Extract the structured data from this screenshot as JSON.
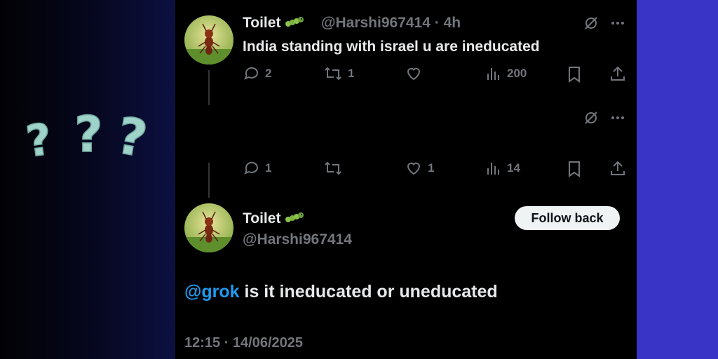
{
  "decor": {
    "question_marks": "???"
  },
  "tweet1": {
    "name": "Toilet",
    "handle": "@Harshi967414",
    "separator": "·",
    "time": "4h",
    "text": "India standing with israel u are ineducated",
    "replies": "2",
    "reposts": "1",
    "likes": "",
    "views": "200"
  },
  "tweet2": {
    "replies": "1",
    "reposts": "",
    "likes": "1",
    "views": "14"
  },
  "main_tweet": {
    "name": "Toilet",
    "handle": "@Harshi967414",
    "follow_label": "Follow back",
    "mention": "@grok",
    "text": " is it ineducated or uneducated",
    "timestamp": "12:15 · 14/06/2025"
  },
  "colors": {
    "accent": "#1d9bf0",
    "muted": "#71767b",
    "text": "#e7e9ea",
    "right_panel": "#3a34c6",
    "question_mark": "#9fd3c9"
  }
}
